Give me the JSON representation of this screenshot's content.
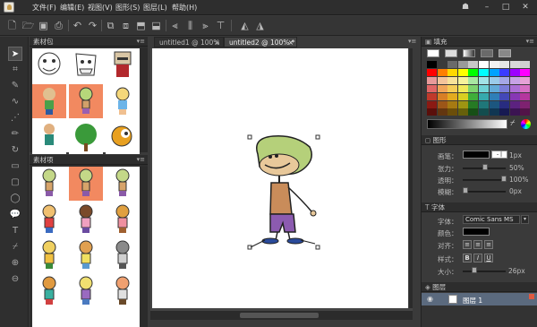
{
  "menu": [
    "文件(F)",
    "编辑(E)",
    "视图(V)",
    "图形(S)",
    "图层(L)",
    "帮助(H)"
  ],
  "panels": {
    "clipart_title": "素材包",
    "items_title": "素材项"
  },
  "tabs": [
    {
      "label": "untitled1 @ 100%",
      "close": "×"
    },
    {
      "label": "untitled2 @ 100% *",
      "close": "×"
    }
  ],
  "right": {
    "fill_title": "填充",
    "shape_title": "图形",
    "font_title": "字体",
    "layer_title": "图层",
    "stroke_label": "画笔：",
    "stroke_value": "1px",
    "tension_label": "张力：",
    "tension_value": "50%",
    "opacity_label": "透明：",
    "opacity_value": "100%",
    "blur_label": "模糊：",
    "blur_value": "0px",
    "font_label": "字体：",
    "font_value": "Comic Sans MS",
    "color_label": "颜色：",
    "align_label": "对齐：",
    "style_label": "样式：",
    "style_b": "B",
    "style_i": "I",
    "style_u": "U",
    "size_label": "大小：",
    "size_value": "26px",
    "layer_name": "图层 1"
  },
  "colors": {
    "palette": [
      [
        "#000000",
        "#3a3a3a",
        "#6a6a6a",
        "#9a9a9a",
        "#c8c8c8",
        "#ffffff",
        "#f2f2f2",
        "#e6e6e6",
        "#d9d9d9",
        "#cfcfcf"
      ],
      [
        "#ff0000",
        "#ff7f00",
        "#ffd800",
        "#ffff00",
        "#00ff00",
        "#00ffff",
        "#00a2ff",
        "#3b3bff",
        "#9c00ff",
        "#ff00ff"
      ],
      [
        "#e89a9a",
        "#f4c49b",
        "#f8e29a",
        "#f6f29c",
        "#a9e7a2",
        "#a3e3e7",
        "#9bcbea",
        "#a5a7e6",
        "#c7a2e6",
        "#e6a2d6"
      ],
      [
        "#e06666",
        "#f0a55a",
        "#f5cd58",
        "#f0e95a",
        "#7ed36f",
        "#6fd2d6",
        "#63abd9",
        "#7a7dd9",
        "#ac6fd6",
        "#d66fc3"
      ],
      [
        "#c0392b",
        "#d87f26",
        "#e3ab1f",
        "#d9cf21",
        "#3fae3a",
        "#35a9ad",
        "#2f7fb8",
        "#4348b8",
        "#8737b5",
        "#b5379e"
      ],
      [
        "#8b1a13",
        "#9c5618",
        "#a67a12",
        "#9e9512",
        "#267a24",
        "#1f7779",
        "#1c567f",
        "#282c80",
        "#5c2280",
        "#7e2270"
      ],
      [
        "#5a0f0b",
        "#633610",
        "#6b4e0a",
        "#66600b",
        "#174f16",
        "#134d4e",
        "#103652",
        "#171a52",
        "#3b1452",
        "#521448"
      ]
    ]
  }
}
